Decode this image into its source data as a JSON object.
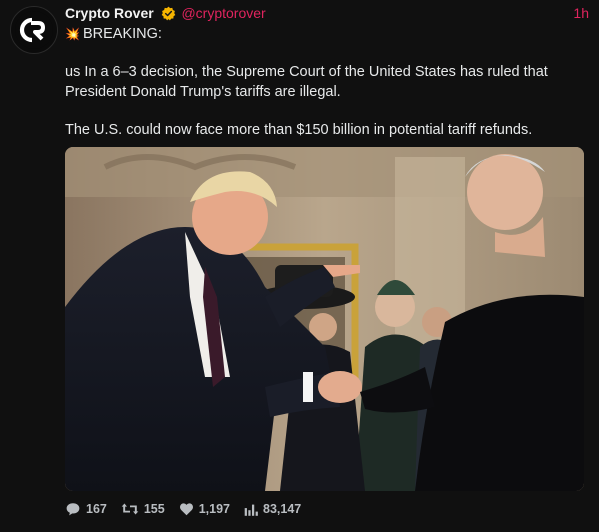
{
  "tweet": {
    "author_name": "Crypto Rover",
    "author_handle": "@cryptorover",
    "time": "1h",
    "avatar_text": "CR",
    "headline": "BREAKING:",
    "paragraph1": "us In a 6–3 decision, the Supreme Court of the United States has ruled that President Donald Trump's tariffs are illegal.",
    "paragraph2": "The U.S. could now face more than $150 billion in potential tariff refunds.",
    "stats": {
      "replies": "167",
      "reposts": "155",
      "likes": "1,197",
      "views": "83,147"
    }
  },
  "colors": {
    "background": "#101010",
    "handle": "#e0245e",
    "verified_badge": "#f5b400",
    "icon": "#b9bdc1"
  },
  "icons": [
    "verified-badge",
    "explosion-emoji",
    "reply-icon",
    "repost-icon",
    "like-icon",
    "views-icon"
  ]
}
